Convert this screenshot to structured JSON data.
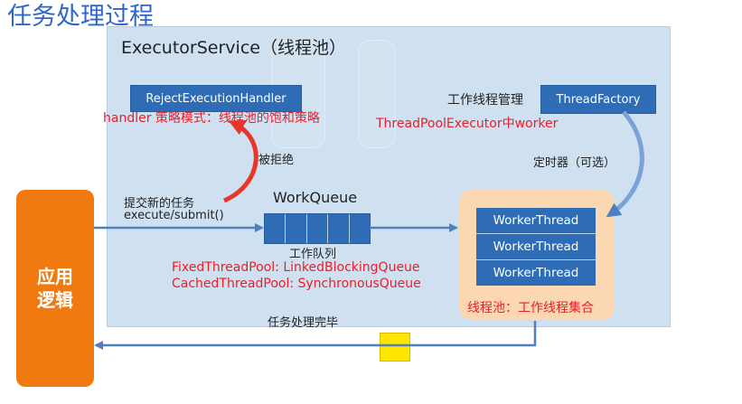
{
  "title": "任务处理过程",
  "service": {
    "title": "ExecutorService（线程池）"
  },
  "reject_handler": {
    "label": "RejectExecutionHandler",
    "note": "handler 策略模式：线程池的饱和策略",
    "rejected_label": "被拒绝"
  },
  "thread_factory": {
    "prefix": "工作线程管理",
    "label": "ThreadFactory",
    "note": "ThreadPoolExecutor中worker",
    "timer_label": "定时器（可选）"
  },
  "submit": {
    "line1": "提交新的任务",
    "line2": "execute/submit()"
  },
  "work_queue": {
    "title": "WorkQueue",
    "caption": "工作队列",
    "note1": "FixedThreadPool: LinkedBlockingQueue",
    "note2": "CachedThreadPool: SynchronousQueue"
  },
  "workers": [
    "WorkerThread",
    "WorkerThread",
    "WorkerThread"
  ],
  "pool": {
    "caption": "线程池：工作线程集合"
  },
  "completed_label": "任务处理完毕",
  "app": {
    "label": "应用逻辑"
  },
  "colors": {
    "title": "#2f66c8",
    "service_bg": "#cfe0f0",
    "box_blue": "#2e6db6",
    "app_orange": "#f07a10",
    "pool_bg": "#fbd7b2",
    "note_red": "#e8202a",
    "arrow_red": "#e8362a",
    "arrow_blue": "#4f7fc0",
    "token_yellow": "#ffe600"
  }
}
